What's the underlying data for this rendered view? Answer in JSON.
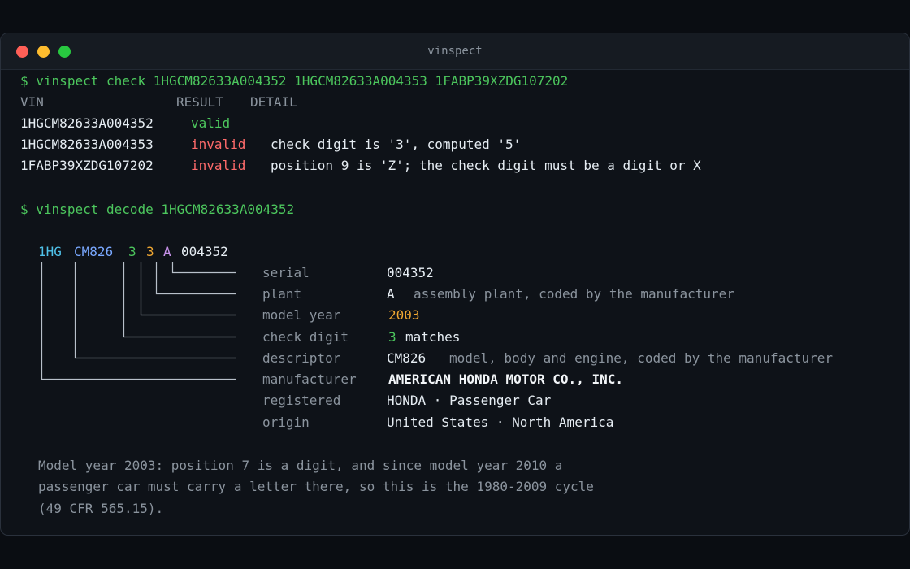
{
  "window": {
    "title": "vinspect"
  },
  "check": {
    "prompt": "$",
    "command": "vinspect check 1HGCM82633A004352 1HGCM82633A004353 1FABP39XZDG107202",
    "headers": {
      "vin": "VIN",
      "result": "RESULT",
      "detail": "DETAIL"
    },
    "rows": [
      {
        "vin": "1HGCM82633A004352",
        "result": "valid",
        "detail": ""
      },
      {
        "vin": "1HGCM82633A004353",
        "result": "invalid",
        "detail": "check digit is '3', computed '5'"
      },
      {
        "vin": "1FABP39XZDG107202",
        "result": "invalid",
        "detail": "position 9 is 'Z'; the check digit must be a digit or X"
      }
    ]
  },
  "decode": {
    "prompt": "$",
    "command": "vinspect decode 1HGCM82633A004352",
    "segments": {
      "wmi": "1HG",
      "vds": "CM826",
      "check": "3",
      "year": "3",
      "plant": "A",
      "serial": "004352"
    },
    "fields": {
      "serial": {
        "label": "serial",
        "value": "004352"
      },
      "plant": {
        "label": "plant",
        "value": "A",
        "note": "assembly plant, coded by the manufacturer"
      },
      "model_year": {
        "label": "model year",
        "value": "2003"
      },
      "check_digit": {
        "label": "check digit",
        "value": "3",
        "note": "matches"
      },
      "descriptor": {
        "label": "descriptor",
        "value": "CM826",
        "note": "model, body and engine, coded by the manufacturer"
      },
      "manufacturer": {
        "label": "manufacturer",
        "value": "AMERICAN HONDA MOTOR CO., INC."
      },
      "registered": {
        "label": "registered",
        "value": "HONDA · Passenger Car"
      },
      "origin": {
        "label": "origin",
        "value": "United States · North America"
      }
    },
    "note_lines": [
      "Model year 2003: position 7 is a digit, and since model year 2010 a",
      "passenger car must carry a letter there, so this is the 1980-2009 cycle",
      "(49 CFR 565.15)."
    ]
  },
  "colors": {
    "prompt": "#4cc65d",
    "valid": "#4cc65d",
    "invalid": "#ff6b6b",
    "wmi": "#4fc1e9",
    "vds": "#79a8ff",
    "check": "#4cc65d",
    "year": "#f0a732",
    "plant": "#c792ea"
  }
}
